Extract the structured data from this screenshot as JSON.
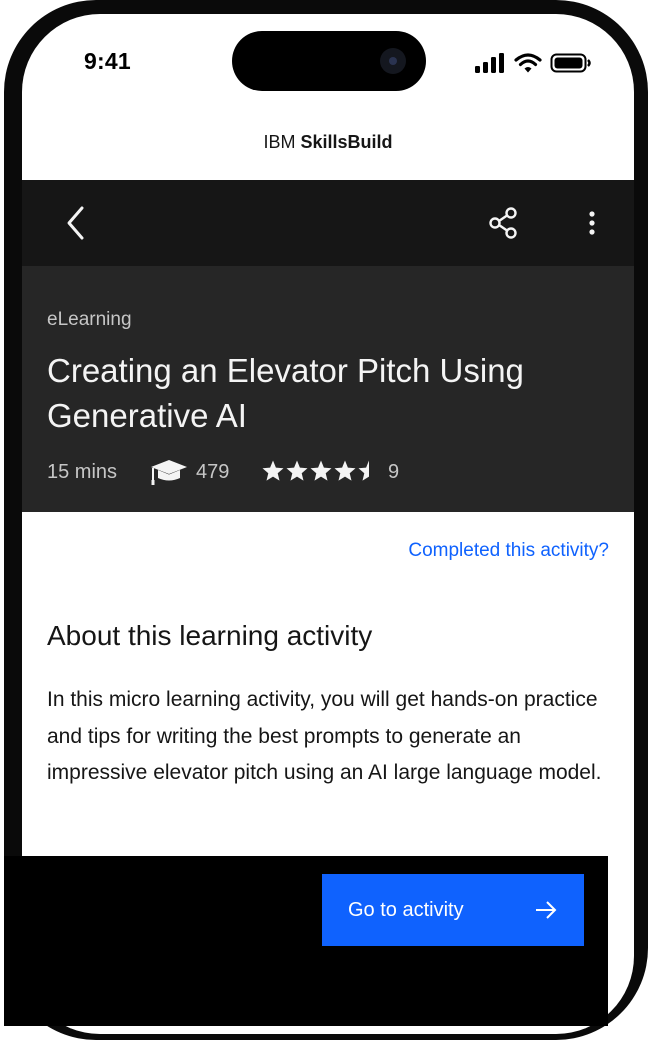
{
  "status_bar": {
    "time": "9:41",
    "icons": [
      "cellular-signal-icon",
      "wifi-icon",
      "battery-icon"
    ]
  },
  "header": {
    "brand_light": "IBM",
    "brand_bold": "SkillsBuild"
  },
  "toolbar": {
    "icons": [
      "chevron-left-icon",
      "share-icon",
      "more-vertical-icon"
    ]
  },
  "course": {
    "category": "eLearning",
    "title": "Creating an Elevator Pitch Using Generative AI",
    "duration": "15 mins",
    "enrollments": "479",
    "rating": 4.5,
    "rating_max": 5,
    "review_count": "9"
  },
  "completed_link": "Completed this activity?",
  "about": {
    "heading": "About this learning activity",
    "body": "In this micro learning activity, you will get hands-on practice and tips for writing the best prompts to generate an impressive elevator pitch using an AI large language model."
  },
  "cta": {
    "label": "Go to activity",
    "icon": "arrow-right-icon"
  },
  "colors": {
    "accent": "#0f62fe",
    "toolbar_bg": "#161616",
    "hero_bg": "#262626",
    "bottom_bar_bg": "#000000"
  }
}
